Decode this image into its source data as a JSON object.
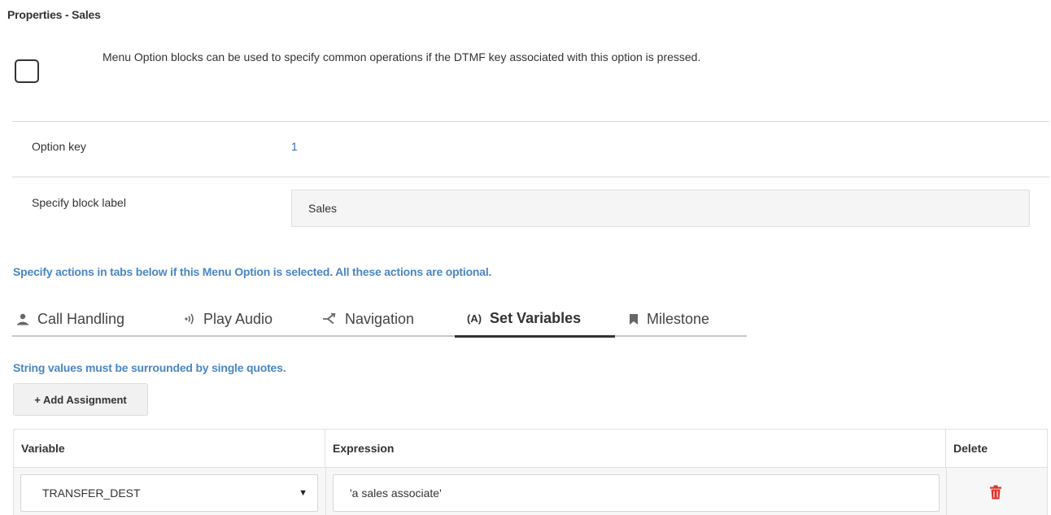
{
  "page": {
    "title": "Properties - Sales",
    "description": "Menu Option blocks can be used to specify common operations if the DTMF key associated with this option is pressed."
  },
  "properties": {
    "option_key_label": "Option key",
    "option_key_value": "1",
    "block_label_label": "Specify block label",
    "block_label_value": "Sales"
  },
  "actions_hint": "Specify actions in tabs below if this Menu Option is selected. All these actions are optional.",
  "tabs": [
    {
      "label": "Call Handling",
      "icon": "person-icon",
      "active": false
    },
    {
      "label": "Play Audio",
      "icon": "audio-icon",
      "active": false
    },
    {
      "label": "Navigation",
      "icon": "branch-icon",
      "active": false
    },
    {
      "label": "Set Variables",
      "icon": "variable-icon",
      "icon_text": "(A)",
      "active": true
    },
    {
      "label": "Milestone",
      "icon": "bookmark-icon",
      "active": false
    }
  ],
  "set_variables": {
    "hint": "String values must be surrounded by single quotes.",
    "add_button_label": "+ Add Assignment",
    "columns": [
      "Variable",
      "Expression",
      "Delete"
    ],
    "rows": [
      {
        "variable": "TRANSFER_DEST",
        "expression": "'a sales associate'"
      }
    ]
  },
  "colors": {
    "hint_blue": "#4a86c5",
    "value_blue": "#3a6cb0",
    "delete_red": "#d9342b"
  }
}
